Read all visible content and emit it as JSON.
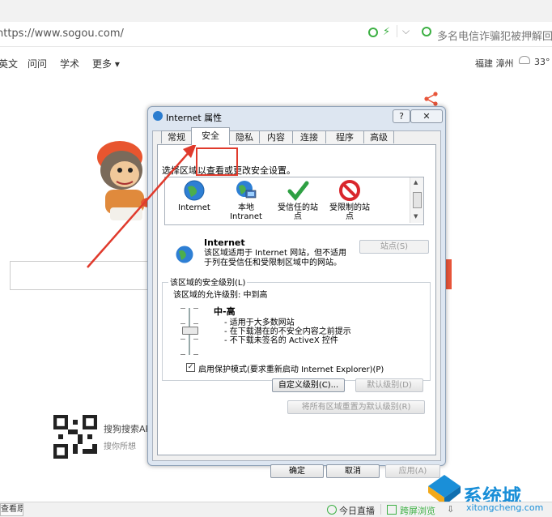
{
  "browser": {
    "url": "https://www.sogou.com/",
    "address_search_placeholder": "多名电信诈骗犯被押解回国",
    "nav": [
      "英文",
      "问问",
      "学术",
      "更多"
    ],
    "weather": {
      "city": "福建 漳州",
      "temp": "33°"
    }
  },
  "page": {
    "qr_title": "搜狗搜索APP",
    "qr_sub": "搜你所想"
  },
  "status_bar": {
    "left": "查看原始",
    "live": "今日直播",
    "split": "跨屏浏览",
    "download": "下载"
  },
  "watermark": {
    "brand": "系统城",
    "url": "xitongcheng.com"
  },
  "dialog": {
    "title": "Internet 属性",
    "help": "?",
    "close": "✕",
    "tabs": [
      "常规",
      "安全",
      "隐私",
      "内容",
      "连接",
      "程序",
      "高级"
    ],
    "selected_tab": "安全",
    "zone_instruction": "选择区域以查看或更改安全设置。",
    "zones": [
      {
        "label": "Internet",
        "icon": "globe-icon"
      },
      {
        "label": "本地\nIntranet",
        "icon": "intranet-icon"
      },
      {
        "label": "受信任的站\n点",
        "icon": "checkmark-icon"
      },
      {
        "label": "受限制的站\n点",
        "icon": "restricted-icon"
      }
    ],
    "selected_zone_name": "Internet",
    "selected_zone_desc": "该区域适用于 Internet 网站，但不适用于列在受信任和受限制区域中的网站。",
    "sites_button": "站点(S)",
    "security_level_title": "该区域的安全级别(L)",
    "allowed_levels": "该区域的允许级别: 中到高",
    "level_name": "中-高",
    "level_bullets": [
      "- 适用于大多数网站",
      "- 在下载潜在的不安全内容之前提示",
      "- 不下载未签名的 ActiveX 控件"
    ],
    "protected_mode_checked": true,
    "protected_mode_label": "启用保护模式(要求重新启动 Internet Explorer)(P)",
    "custom_level_button": "自定义级别(C)...",
    "default_level_button": "默认级别(D)",
    "reset_all_button": "将所有区域重置为默认级别(R)",
    "ok_button": "确定",
    "cancel_button": "取消",
    "apply_button": "应用(A)"
  }
}
